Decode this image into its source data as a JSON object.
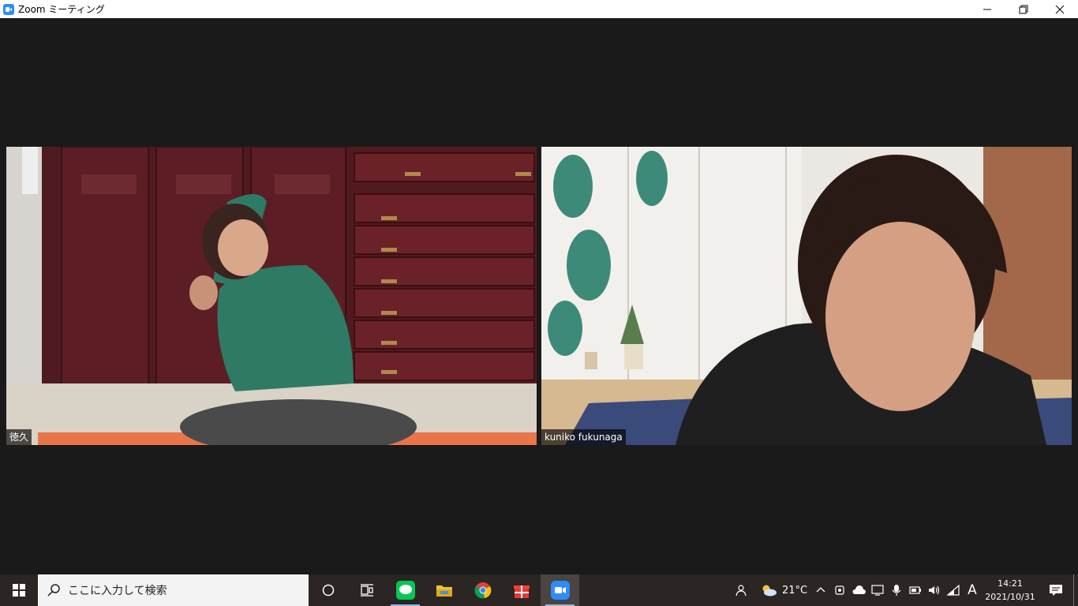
{
  "window": {
    "title": "Zoom ミーティング",
    "controls": {
      "minimize": "—",
      "restore": "❐",
      "close": "✕"
    }
  },
  "participants": [
    {
      "name": "徳久"
    },
    {
      "name": "kuniko fukunaga"
    }
  ],
  "taskbar": {
    "search_placeholder": "ここに入力して検索",
    "apps": [
      "cortana-icon",
      "task-view-icon",
      "line-icon",
      "file-explorer-icon",
      "chrome-icon",
      "gift-icon",
      "zoom-icon"
    ],
    "weather": {
      "temp": "21°C",
      "icon": "partly-cloudy-icon"
    },
    "ime": "A",
    "clock": {
      "time": "14:21",
      "date": "2021/10/31"
    },
    "colors": {
      "accent": "#2d8cff",
      "line_green": "#06c755"
    }
  }
}
